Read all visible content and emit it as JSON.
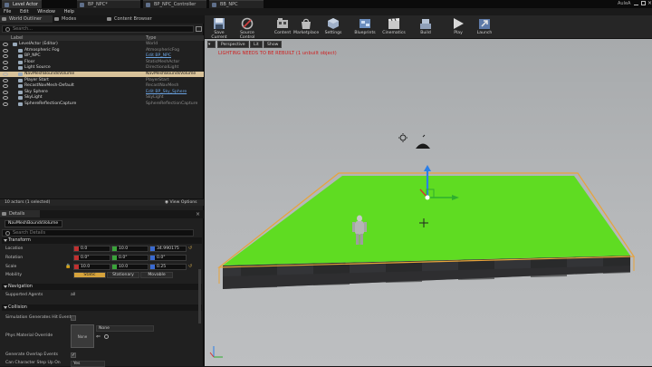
{
  "window": {
    "tabs": [
      {
        "label": "Level Actor",
        "active": true
      },
      {
        "label": "BP_NPC*",
        "active": false
      },
      {
        "label": "BP_NPC_Controller",
        "active": false
      },
      {
        "label": "BB_NPC",
        "active": false
      }
    ],
    "user": "AuleA"
  },
  "menu": [
    "File",
    "Edit",
    "Window",
    "Help"
  ],
  "outliner": {
    "tabs": [
      "World Outliner",
      "Modes",
      "Content Browser"
    ],
    "search_placeholder": "Search...",
    "columns": [
      "Label",
      "Type"
    ],
    "rows": [
      {
        "label": "LevelActor (Editor)",
        "type": "World",
        "link": false,
        "selected": false,
        "indent": 0
      },
      {
        "label": "Atmospheric Fog",
        "type": "AtmosphericFog",
        "link": false,
        "selected": false,
        "indent": 1
      },
      {
        "label": "BP_NPC",
        "type": "Edit BP_NPC",
        "link": true,
        "selected": false,
        "indent": 1
      },
      {
        "label": "Floor",
        "type": "StaticMeshActor",
        "link": false,
        "selected": false,
        "indent": 1
      },
      {
        "label": "Light Source",
        "type": "DirectionalLight",
        "link": false,
        "selected": false,
        "indent": 1
      },
      {
        "label": "NavMeshBoundsVolume",
        "type": "NavMeshBoundsVolume",
        "link": false,
        "selected": true,
        "indent": 1
      },
      {
        "label": "Player Start",
        "type": "PlayerStart",
        "link": false,
        "selected": false,
        "indent": 1
      },
      {
        "label": "RecastNavMesh-Default",
        "type": "RecastNavMesh",
        "link": false,
        "selected": false,
        "indent": 1
      },
      {
        "label": "Sky Sphere",
        "type": "Edit BP_Sky_Sphere",
        "link": true,
        "selected": false,
        "indent": 1
      },
      {
        "label": "SkyLight",
        "type": "SkyLight",
        "link": false,
        "selected": false,
        "indent": 1
      },
      {
        "label": "SphereReflectionCapture",
        "type": "SphereReflectionCapture",
        "link": false,
        "selected": false,
        "indent": 1
      }
    ],
    "footer": "10 actors (1 selected)",
    "view_options": "View Options"
  },
  "details": {
    "tab": "Details",
    "name_value": "NavMeshBoundsVolume",
    "search_placeholder": "Search Details",
    "sections": {
      "transform": "Transform",
      "navigation": "Navigation",
      "collision": "Collision"
    },
    "transform": {
      "location": {
        "label": "Location",
        "x": "0.0",
        "y": "10.0",
        "z": "34.990175"
      },
      "rotation": {
        "label": "Rotation",
        "x": "0.0°",
        "y": "0.0°",
        "z": "0.0°"
      },
      "scale": {
        "label": "Scale",
        "x": "10.0",
        "y": "10.0",
        "z": "0.25"
      },
      "mobility": {
        "label": "Mobility",
        "options": [
          "Static",
          "Stationary",
          "Movable"
        ],
        "selected": "Static"
      }
    },
    "navigation": {
      "supported_agents_label": "Supported Agents",
      "supported_agents_value": "all"
    },
    "collision": {
      "sim_hit_events": "Simulation Generates Hit Events",
      "phys_override": "Phys Material Override",
      "phys_value": "None",
      "phys_thumb": "None",
      "overlap_events": "Generate Overlap Events",
      "step_up": "Can Character Step Up On",
      "step_up_value": "Yes"
    }
  },
  "toolbar": [
    {
      "label": "Save Current",
      "icon": "save-icon"
    },
    {
      "label": "Source Control",
      "icon": "source-control-icon"
    },
    {
      "label": "Content",
      "icon": "content-icon"
    },
    {
      "label": "Marketplace",
      "icon": "marketplace-icon"
    },
    {
      "label": "Settings",
      "icon": "settings-icon"
    },
    {
      "label": "Blueprints",
      "icon": "blueprints-icon"
    },
    {
      "label": "Cinematics",
      "icon": "cinematics-icon"
    },
    {
      "label": "Build",
      "icon": "build-icon"
    },
    {
      "label": "Play",
      "icon": "play-icon"
    },
    {
      "label": "Launch",
      "icon": "launch-icon"
    }
  ],
  "viewport": {
    "perspective": "Perspective",
    "lit": "Lit",
    "show": "Show",
    "warning": "LIGHTING NEEDS TO BE REBUILT (1 unbuilt object)"
  },
  "colors": {
    "floor_green": "#5fdc22",
    "selection_orange": "#e8a33a",
    "warning_red": "#d01c1c",
    "link_blue": "#6aa2e0"
  }
}
